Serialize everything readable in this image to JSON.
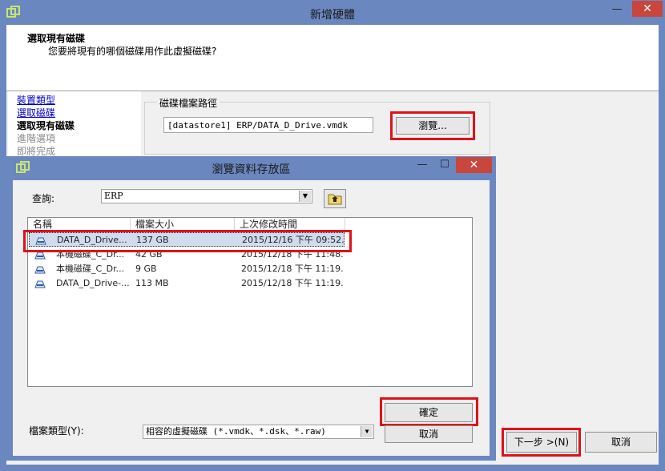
{
  "outer": {
    "title": "新增硬體",
    "minimize": "—",
    "close": "✕",
    "header_title": "選取現有磁碟",
    "header_subtitle": "您要將現有的哪個磁碟用作此虛擬磁碟?",
    "steps": [
      {
        "label": "裝置類型",
        "state": "link"
      },
      {
        "label": "選取磁碟",
        "state": "link"
      },
      {
        "label": "選取現有磁碟",
        "state": "current"
      },
      {
        "label": "進階選項",
        "state": "disabled"
      },
      {
        "label": "即將完成",
        "state": "disabled"
      }
    ],
    "path_group_label": "磁碟檔案路徑",
    "path_value": "[datastore1] ERP/DATA_D_Drive.vmdk",
    "browse_label": "瀏覽...",
    "next_label": "下一步 >(N)",
    "cancel_label": "取消"
  },
  "dialog": {
    "title": "瀏覽資料存放區",
    "minimize": "—",
    "maximize": "☐",
    "close": "✕",
    "lookin_label": "查詢:",
    "lookin_value": "ERP",
    "columns": [
      "名稱",
      "檔案大小",
      "上次修改時間"
    ],
    "files": [
      {
        "name": "DATA_D_Drive...",
        "size": "137 GB",
        "modified": "2015/12/16 下午 09:52..."
      },
      {
        "name": "本機磁碟_C_Dr...",
        "size": "42 GB",
        "modified": "2015/12/18 下午 11:48..."
      },
      {
        "name": "本機磁碟_C_Dr...",
        "size": "9 GB",
        "modified": "2015/12/18 下午 11:19..."
      },
      {
        "name": "DATA_D_Drive-...",
        "size": "113 MB",
        "modified": "2015/12/18 下午 11:19..."
      }
    ],
    "ok_label": "確定",
    "cancel_label": "取消",
    "filetype_label": "檔案類型(Y):",
    "filetype_value": "相容的虛擬磁碟 (*.vmdk、*.dsk、*.raw)"
  },
  "colors": {
    "titlebar": "#6b87c0",
    "highlight": "#e0111a",
    "close": "#c9463d",
    "selection": "#d0dcee"
  }
}
